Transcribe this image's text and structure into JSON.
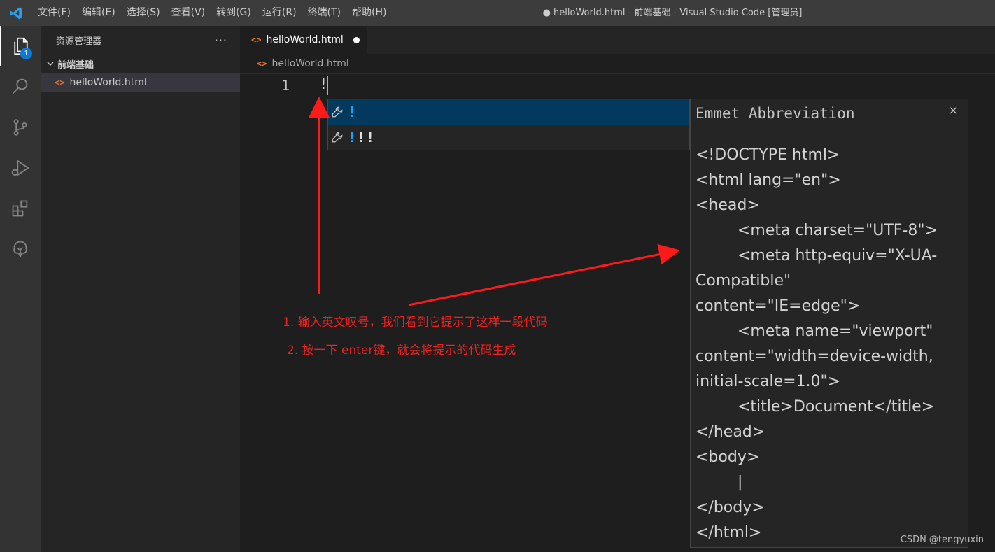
{
  "titlebar": {
    "menu": [
      "文件(F)",
      "编辑(E)",
      "选择(S)",
      "查看(V)",
      "转到(G)",
      "运行(R)",
      "终端(T)",
      "帮助(H)"
    ],
    "window_title": "● helloWorld.html - 前端基础 - Visual Studio Code [管理员]"
  },
  "activitybar": {
    "explorer_badge": "1",
    "icons": [
      "files-icon",
      "search-icon",
      "source-control-icon",
      "run-debug-icon",
      "extensions-icon",
      "tree-icon"
    ]
  },
  "sidebar": {
    "title": "资源管理器",
    "more": "···",
    "folder": "前端基础",
    "file": "helloWorld.html"
  },
  "editor": {
    "tab_label": "helloWorld.html",
    "breadcrumb": "helloWorld.html",
    "line_number": "1",
    "code": "!"
  },
  "suggest": {
    "items": [
      {
        "highlight": "!",
        "rest": ""
      },
      {
        "highlight": "!",
        "rest": "!!"
      }
    ]
  },
  "details": {
    "title": "Emmet Abbreviation",
    "close": "×",
    "lines": [
      {
        "text": "<!DOCTYPE html>",
        "indent": 0
      },
      {
        "text": "<html lang=\"en\">",
        "indent": 0
      },
      {
        "text": "<head>",
        "indent": 0
      },
      {
        "text": "<meta charset=\"UTF-8\">",
        "indent": 1
      },
      {
        "text": "<meta http-equiv=\"X-UA-",
        "indent": 1
      },
      {
        "text": "Compatible\"",
        "indent": 0
      },
      {
        "text": "content=\"IE=edge\">",
        "indent": 0
      },
      {
        "text": "<meta name=\"viewport\"",
        "indent": 1
      },
      {
        "text": "content=\"width=device-width,",
        "indent": 0
      },
      {
        "text": "initial-scale=1.0\">",
        "indent": 0
      },
      {
        "text": "<title>Document</title>",
        "indent": 1
      },
      {
        "text": "</head>",
        "indent": 0
      },
      {
        "text": "<body>",
        "indent": 0
      },
      {
        "text": "|",
        "indent": 1
      },
      {
        "text": "</body>",
        "indent": 0
      },
      {
        "text": "</html>",
        "indent": 0
      }
    ]
  },
  "annotations": {
    "note1": "1. 输入英文叹号，我们看到它提示了这样一段代码",
    "note2": "2. 按一下 enter键，就会将提示的代码生成"
  },
  "watermark": "CSDN @tengyuxin"
}
